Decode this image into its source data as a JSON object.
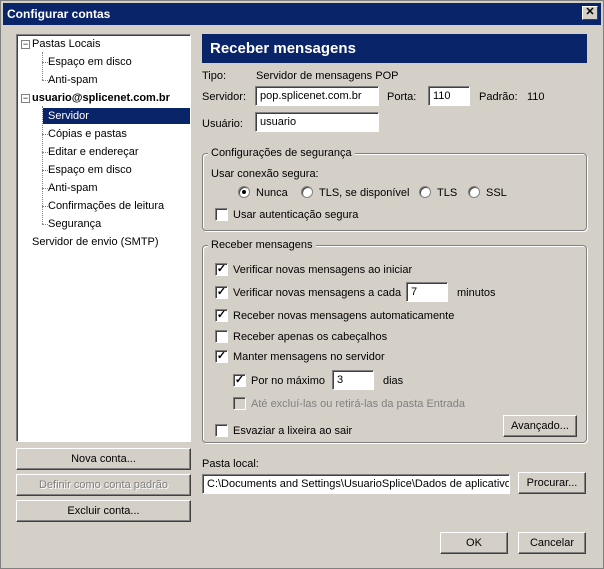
{
  "window": {
    "title": "Configurar contas",
    "close_symbol": "✕"
  },
  "tree": {
    "items": [
      {
        "label": "Pastas Locais",
        "kind": "root"
      },
      {
        "label": "Espaço em disco",
        "kind": "child"
      },
      {
        "label": "Anti-spam",
        "kind": "child"
      },
      {
        "label": "usuario@splicenet.com.br",
        "kind": "root"
      },
      {
        "label": "Servidor",
        "kind": "child",
        "selected": true
      },
      {
        "label": "Cópias e pastas",
        "kind": "child"
      },
      {
        "label": "Editar e endereçar",
        "kind": "child"
      },
      {
        "label": "Espaço em disco",
        "kind": "child"
      },
      {
        "label": "Anti-spam",
        "kind": "child"
      },
      {
        "label": "Confirmações de leitura",
        "kind": "child"
      },
      {
        "label": "Segurança",
        "kind": "child"
      },
      {
        "label": "Servidor de envio (SMTP)",
        "kind": "root"
      }
    ],
    "expander_symbol": "−"
  },
  "left_buttons": {
    "new_account": "Nova conta...",
    "set_default": "Definir como conta padrão",
    "delete_account": "Excluir conta..."
  },
  "panel": {
    "header": "Receber mensagens",
    "type_label": "Tipo:",
    "type_value": "Servidor de mensagens POP",
    "server_label": "Servidor:",
    "server_value": "pop.splicenet.com.br",
    "port_label": "Porta:",
    "port_value": "110",
    "default_label": "Padrão:",
    "default_value": "110",
    "user_label": "Usuário:",
    "user_value": "usuario"
  },
  "security": {
    "title": "Configurações de segurança",
    "use_secure_label": "Usar conexão segura:",
    "options": [
      "Nunca",
      "TLS, se disponível",
      "TLS",
      "SSL"
    ],
    "selected": "Nunca",
    "secure_auth": "Usar autenticação segura",
    "secure_auth_checked": false
  },
  "receive": {
    "title": "Receber mensagens",
    "check_on_start": "Verificar novas mensagens ao iniciar",
    "check_every": "Verificar novas mensagens a cada",
    "check_every_value": "7",
    "minutes": "minutos",
    "auto_download": "Receber novas mensagens automaticamente",
    "headers_only": "Receber apenas os cabeçalhos",
    "leave_on_server": "Manter mensagens no servidor",
    "max_days": "Por no máximo",
    "max_days_value": "3",
    "days": "dias",
    "until_deleted": "Até excluí-las ou retirá-las da pasta Entrada",
    "empty_trash": "Esvaziar a lixeira ao sair",
    "advanced_button": "Avançado...",
    "check_mark": "✓"
  },
  "local_folder": {
    "label": "Pasta local:",
    "value": "C:\\Documents and Settings\\UsuarioSplice\\Dados de aplicativo",
    "browse_button": "Procurar..."
  },
  "dialog_buttons": {
    "ok": "OK",
    "cancel": "Cancelar"
  }
}
